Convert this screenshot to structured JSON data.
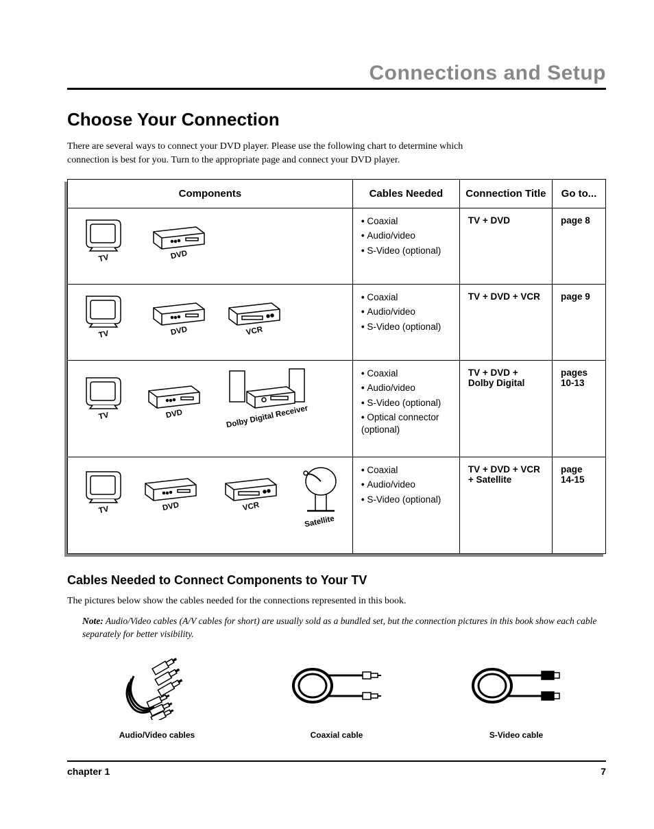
{
  "section_header": "Connections and Setup",
  "main_heading": "Choose Your Connection",
  "intro": "There are several ways to connect your DVD player. Please use the following chart to determine which connection is best for you. Turn to the appropriate page and connect your DVD player.",
  "table": {
    "headers": {
      "components": "Components",
      "cables": "Cables Needed",
      "title": "Connection Title",
      "goto": "Go to..."
    },
    "rows": [
      {
        "devices": [
          "TV",
          "DVD"
        ],
        "cables": [
          "Coaxial",
          "Audio/video",
          "S-Video (optional)"
        ],
        "title": "TV + DVD",
        "goto": "page 8"
      },
      {
        "devices": [
          "TV",
          "DVD",
          "VCR"
        ],
        "cables": [
          "Coaxial",
          "Audio/video",
          "S-Video (optional)"
        ],
        "title": "TV + DVD  + VCR",
        "goto": "page 9"
      },
      {
        "devices": [
          "TV",
          "DVD",
          "Dolby Digital Receiver"
        ],
        "cables": [
          "Coaxial",
          "Audio/video",
          "S-Video (optional)",
          "Optical connector (optional)"
        ],
        "title": "TV + DVD + Dolby Digital",
        "goto": "pages 10-13"
      },
      {
        "devices": [
          "TV",
          "DVD",
          "VCR",
          "Satellite"
        ],
        "cables": [
          "Coaxial",
          "Audio/video",
          "S-Video (optional)"
        ],
        "title": "TV + DVD + VCR + Satellite",
        "goto": "page 14-15"
      }
    ]
  },
  "sub_heading": "Cables Needed to Connect Components to Your TV",
  "sub_intro": "The pictures below show the cables needed for the connections represented in this book.",
  "note_label": "Note:",
  "note_text": " Audio/Video cables (A/V cables for short) are usually sold as a bundled set, but the connection pictures in this book show each cable separately for better visibility.",
  "cables": [
    {
      "caption": "Audio/Video cables"
    },
    {
      "caption": "Coaxial cable"
    },
    {
      "caption": "S-Video cable"
    }
  ],
  "footer": {
    "left": "chapter 1",
    "right": "7"
  }
}
